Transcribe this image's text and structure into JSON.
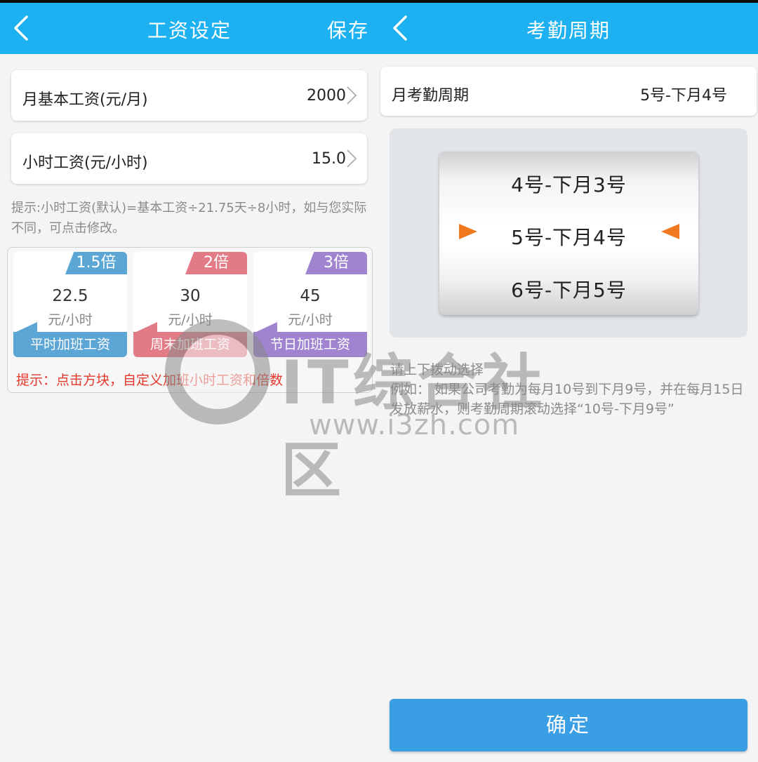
{
  "left": {
    "header": {
      "title": "工资设定",
      "save_label": "保存"
    },
    "base_salary": {
      "label": "月基本工资(元/月)",
      "value": "2000"
    },
    "hourly_salary": {
      "label": "小时工资(元/小时)",
      "value": "15.0"
    },
    "hint": "提示:小时工资(默认)=基本工资÷21.75天÷8小时，如与您实际不同，可点击修改。",
    "overtime": [
      {
        "multiplier": "1.5倍",
        "amount": "22.5",
        "unit": "元/小时",
        "label": "平时加班工资",
        "color": "#5ca6d6"
      },
      {
        "multiplier": "2倍",
        "amount": "30",
        "unit": "元/小时",
        "label": "周末加班工资",
        "color": "#e27b86"
      },
      {
        "multiplier": "3倍",
        "amount": "45",
        "unit": "元/小时",
        "label": "节日加班工资",
        "color": "#a084d0"
      }
    ],
    "overtime_tip": "提示：点击方块，自定义加班小时工资和倍数"
  },
  "right": {
    "header": {
      "title": "考勤周期"
    },
    "period": {
      "label": "月考勤周期",
      "value": "5号-下月4号"
    },
    "picker": {
      "items": [
        "4号-下月3号",
        "5号-下月4号",
        "6号-下月5号"
      ]
    },
    "instruction": {
      "line1": "请上下拨动选择",
      "line2": "例如：  如果公司考勤为每月10号到下月9号，并在每月15日发放薪水，则考勤周期滚动选择“10号-下月9号”"
    },
    "confirm_label": "确定"
  },
  "watermark": {
    "text": "IT综合社区",
    "url": "www.i3zh.com"
  }
}
